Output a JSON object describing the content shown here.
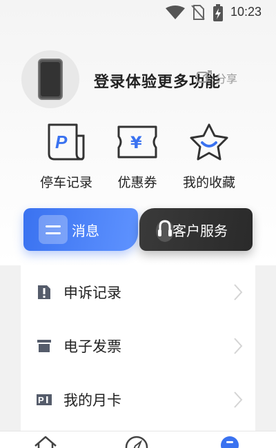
{
  "status_bar": {
    "time": "10:23",
    "icons": [
      "wifi-icon",
      "no-sim-icon",
      "battery-charging-icon"
    ]
  },
  "profile": {
    "login_prompt": "登录体验更多功能",
    "share_label": "分享"
  },
  "quick_actions": [
    {
      "label": "停车记录",
      "icon": "parking-ticket-icon"
    },
    {
      "label": "优惠券",
      "icon": "coupon-icon"
    },
    {
      "label": "我的收藏",
      "icon": "star-icon"
    }
  ],
  "cards": {
    "messages_label": "消息",
    "service_label": "客户服务"
  },
  "menu": [
    {
      "label": "申诉记录",
      "icon": "appeal-icon"
    },
    {
      "label": "电子发票",
      "icon": "invoice-icon"
    },
    {
      "label": "我的月卡",
      "icon": "monthly-card-icon"
    }
  ],
  "bottom_nav": {
    "items": [
      "home-icon",
      "compass-icon",
      "profile-icon"
    ]
  },
  "colors": {
    "accent": "#3a72f0",
    "dark_card": "#333333",
    "text": "#222222"
  }
}
